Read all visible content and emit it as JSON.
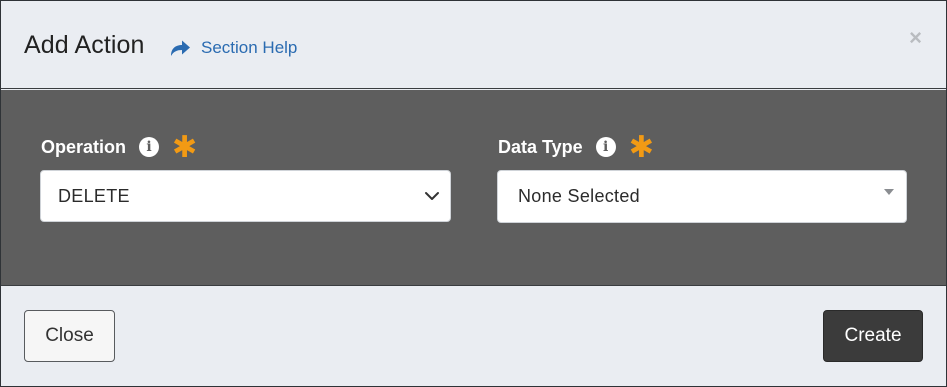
{
  "header": {
    "title": "Add Action",
    "help_label": "Section Help",
    "close_symbol": "×"
  },
  "form": {
    "operation": {
      "label": "Operation",
      "info_symbol": "i",
      "required_symbol": "✱",
      "value": "DELETE"
    },
    "data_type": {
      "label": "Data Type",
      "info_symbol": "i",
      "required_symbol": "✱",
      "value": "None Selected"
    }
  },
  "footer": {
    "close_label": "Close",
    "create_label": "Create"
  },
  "colors": {
    "accent_link": "#2a6bb1",
    "required": "#f29a14",
    "body_bg": "#5e5e5e",
    "primary_button": "#3b3b3b"
  },
  "icons": {
    "help": "share-arrow-icon",
    "info": "info-icon",
    "required": "asterisk-icon",
    "dropdown": "chevron-down-icon",
    "dropdown2": "caret-down-icon",
    "dismiss": "close-icon"
  }
}
